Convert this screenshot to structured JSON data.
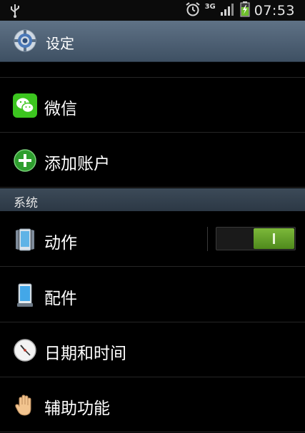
{
  "status_bar": {
    "network": "3G",
    "time": "07:53",
    "icons": [
      "usb-icon",
      "alarm-icon",
      "signal-icon",
      "battery-charging-icon"
    ]
  },
  "title_bar": {
    "title": "设定",
    "icon": "settings-gear-icon"
  },
  "list": {
    "wechat": {
      "label": "微信",
      "icon": "wechat-icon"
    },
    "add_account": {
      "label": "添加账户",
      "icon": "add-icon"
    }
  },
  "section": {
    "title": "系统"
  },
  "system_items": {
    "motion": {
      "label": "动作",
      "icon": "motion-phone-icon",
      "toggle_on": true
    },
    "accessories": {
      "label": "配件",
      "icon": "accessory-phone-icon"
    },
    "date_time": {
      "label": "日期和时间",
      "icon": "clock-icon"
    },
    "accessibility": {
      "label": "辅助功能",
      "icon": "hand-icon"
    }
  },
  "colors": {
    "title_bar": "#4f6275",
    "toggle_on": "#6aa62e",
    "wechat": "#3cc51f",
    "add": "#2e9e2e"
  }
}
